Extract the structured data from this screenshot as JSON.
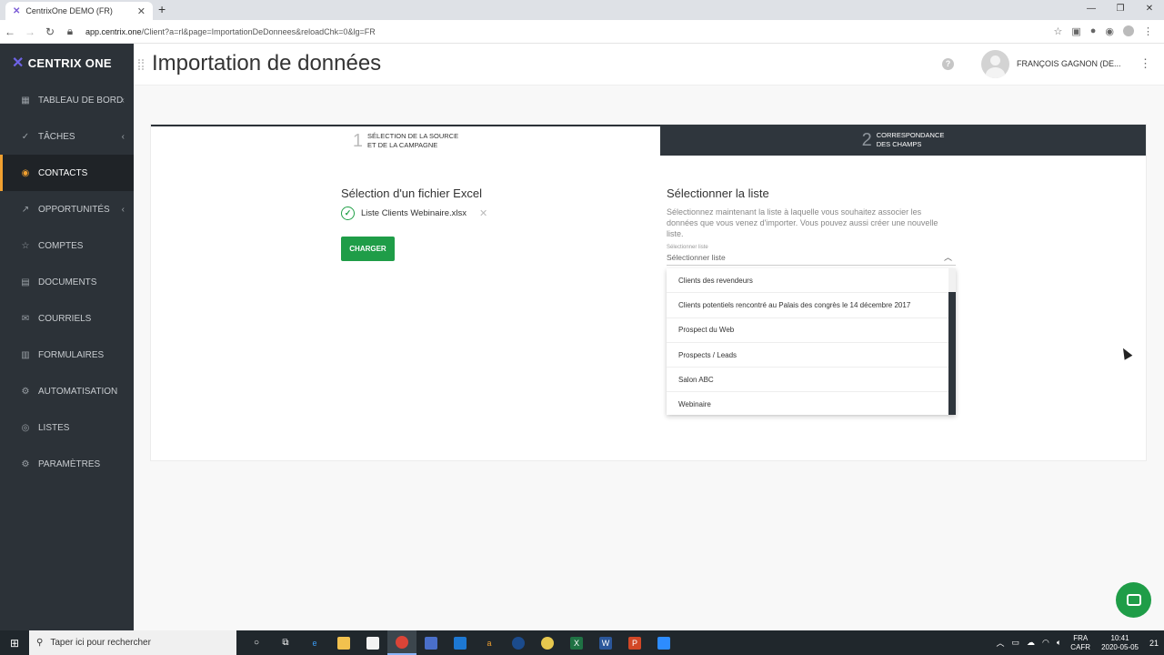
{
  "browser": {
    "tab_title": "CentrixOne DEMO (FR)",
    "tab_close": "✕",
    "new_tab": "+",
    "url_host": "app.centrix.one",
    "url_path": "/Client?a=rl&page=ImportationDeDonnees&reloadChk=0&lg=FR"
  },
  "sidebar": {
    "brand": "CENTRIX ONE",
    "items": [
      {
        "label": "TABLEAU DE BORD",
        "icon": "dashboard-icon",
        "chevron": "‹"
      },
      {
        "label": "TÂCHES",
        "icon": "check-circle-icon",
        "chevron": "‹"
      },
      {
        "label": "CONTACTS",
        "icon": "user-circle-icon",
        "chevron": ""
      },
      {
        "label": "OPPORTUNITÉS",
        "icon": "trend-icon",
        "chevron": "‹"
      },
      {
        "label": "COMPTES",
        "icon": "star-icon",
        "chevron": ""
      },
      {
        "label": "DOCUMENTS",
        "icon": "document-icon",
        "chevron": ""
      },
      {
        "label": "COURRIELS",
        "icon": "mail-icon",
        "chevron": ""
      },
      {
        "label": "FORMULAIRES",
        "icon": "clipboard-icon",
        "chevron": ""
      },
      {
        "label": "AUTOMATISATION",
        "icon": "automation-icon",
        "chevron": ""
      },
      {
        "label": "LISTES",
        "icon": "fingerprint-icon",
        "chevron": ""
      },
      {
        "label": "PARAMÈTRES",
        "icon": "gear-icon",
        "chevron": ""
      }
    ],
    "active_item": "CONTACTS"
  },
  "header": {
    "title": "Importation de données",
    "help": "?",
    "user_name": "FRANÇOIS GAGNON (DE..."
  },
  "steps": [
    {
      "num": "1",
      "line1": "SÉLECTION DE LA SOURCE",
      "line2": "ET DE LA CAMPAGNE"
    },
    {
      "num": "2",
      "line1": "CORRESPONDANCE",
      "line2": "DES CHAMPS"
    }
  ],
  "file_section": {
    "title": "Sélection d'un fichier Excel",
    "file_name": "Liste Clients Webinaire.xlsx",
    "upload_button": "CHARGER"
  },
  "list_section": {
    "title": "Sélectionner la liste",
    "description": "Sélectionnez maintenant la liste à laquelle vous souhaitez associer les données que vous venez d'importer. Vous pouvez aussi créer une nouvelle liste.",
    "field_label": "Sélectionner liste",
    "field_placeholder": "Sélectionner liste",
    "options": [
      "Clients des revendeurs",
      "Clients potentiels rencontré au Palais des congrès le 14 décembre 2017",
      "Prospect du Web",
      "Prospects / Leads",
      "Salon ABC",
      "Webinaire"
    ]
  },
  "taskbar": {
    "search_placeholder": "Taper ici pour rechercher",
    "lang_line1": "FRA",
    "lang_line2": "CAFR",
    "time": "10:41",
    "date": "2020-05-05",
    "notifications": "21"
  },
  "colors": {
    "sidebar_bg": "#2c3238",
    "active_accent": "#f0a030",
    "primary_green": "#1f9d48",
    "step2_bg": "#2f363d",
    "brand_accent": "#6e63e6"
  }
}
